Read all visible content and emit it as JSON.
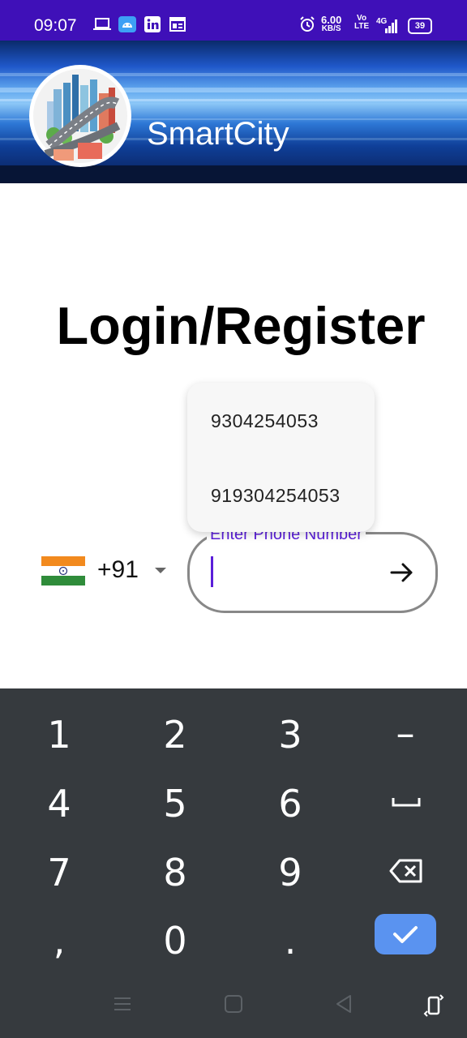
{
  "status_bar": {
    "time": "09:07",
    "net_speed": "6.00",
    "net_unit": "KB/S",
    "volte_top": "Vo",
    "volte_bottom": "LTE",
    "network": "4G",
    "battery": "39",
    "icons": [
      "laptop-icon",
      "android-icon",
      "linkedin-icon",
      "calendar-icon",
      "alarm-icon",
      "signal-icon"
    ]
  },
  "header": {
    "app_name": "SmartCity",
    "logo": "smartcity-logo"
  },
  "login": {
    "title": "Login/Register"
  },
  "suggestions": [
    "9304254053",
    "919304254053"
  ],
  "phone": {
    "country_flag": "india-flag-icon",
    "country_code": "+91",
    "label": "Enter Phone Number",
    "value": ""
  },
  "keyboard": {
    "rows": [
      [
        "1",
        "2",
        "3",
        "-"
      ],
      [
        "4",
        "5",
        "6",
        "space"
      ],
      [
        "7",
        "8",
        "9",
        "backspace"
      ],
      [
        ",",
        "0",
        ".",
        "done"
      ]
    ],
    "key_labels": {
      "k1": "1",
      "k2": "2",
      "k3": "3",
      "k4": "4",
      "k5": "5",
      "k6": "6",
      "k7": "7",
      "k8": "8",
      "k9": "9",
      "k0": "0",
      "comma": ",",
      "dot": ".",
      "dash": "–"
    },
    "accent": "#5a93f0"
  },
  "nav_bar": [
    "menu-icon",
    "home-icon",
    "back-icon",
    "rotate-icon"
  ],
  "colors": {
    "status_bar": "#3f10b8",
    "accent_purple": "#5a1ed9",
    "keyboard_bg": "#363a3e"
  }
}
